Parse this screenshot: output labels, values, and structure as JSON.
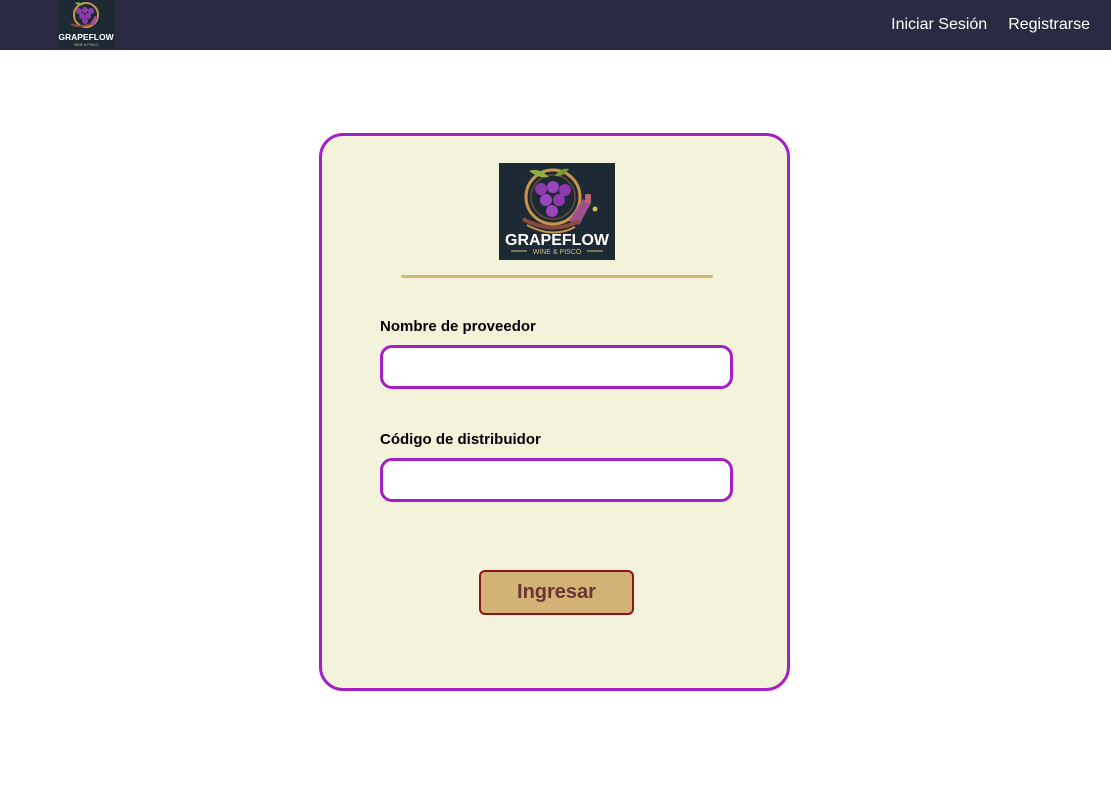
{
  "navbar": {
    "logo_text": "GRAPEFLOW",
    "logo_subtext": "WINE & PISCO",
    "links": [
      {
        "label": "Iniciar Sesión"
      },
      {
        "label": "Registrarse"
      }
    ]
  },
  "form": {
    "logo_text": "GRAPEFLOW",
    "logo_subtext": "WINE & PISCO",
    "fields": [
      {
        "label": "Nombre de proveedor",
        "value": "",
        "placeholder": ""
      },
      {
        "label": "Código de distribuidor",
        "value": "",
        "placeholder": ""
      }
    ],
    "submit_label": "Ingresar"
  },
  "colors": {
    "navbar_bg": "#2a2a42",
    "card_bg": "#f3f2da",
    "accent_border": "#a51fc7",
    "divider": "#d3b978",
    "button_bg": "#d2b276",
    "button_border": "#8c1616",
    "button_text": "#6b3531",
    "grape": "#8e3bb0",
    "leaf": "#8fb13c"
  }
}
